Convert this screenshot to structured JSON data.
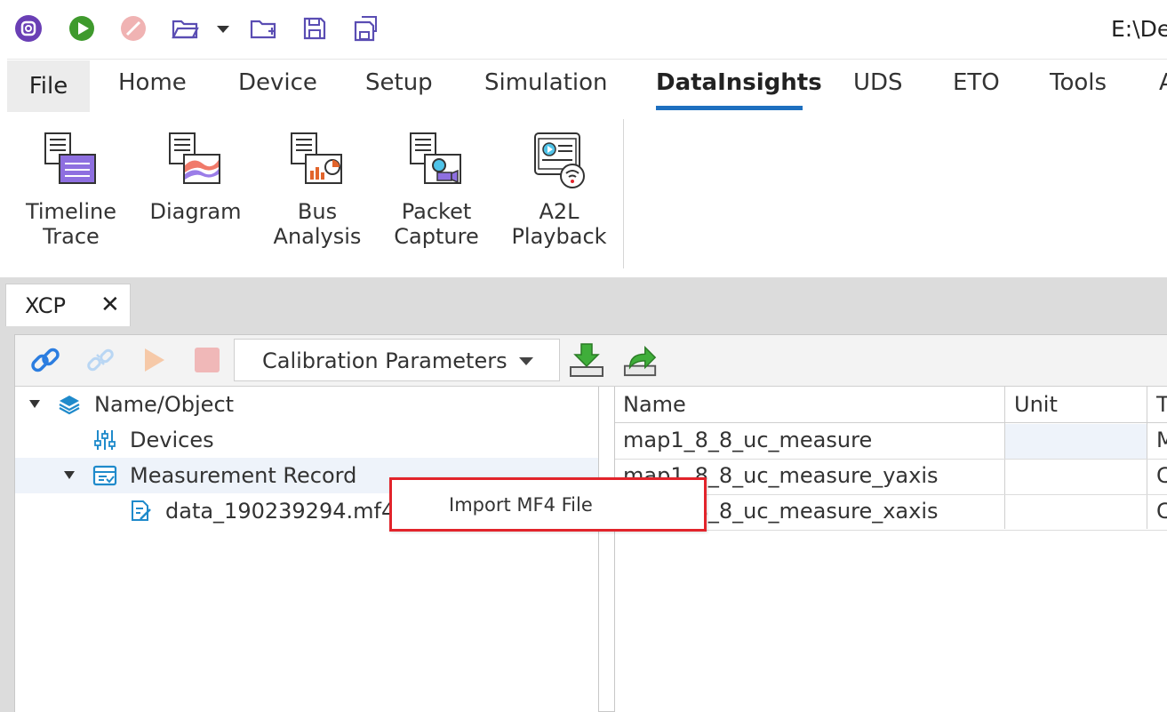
{
  "quick_access": {
    "icons": [
      "app-logo-icon",
      "run-icon",
      "stop-icon",
      "open-folder-icon",
      "dropdown-icon",
      "new-folder-icon",
      "save-icon",
      "save-as-icon"
    ],
    "path_text": "E:\\De"
  },
  "ribbon_tabs": {
    "file": "File",
    "items": [
      "Home",
      "Device",
      "Setup",
      "Simulation",
      "DataInsights",
      "UDS",
      "ETO",
      "Tools",
      "A"
    ],
    "active": "DataInsights"
  },
  "ribbon_buttons": [
    {
      "line1": "Timeline",
      "line2": "Trace",
      "icon": "timeline-trace-icon"
    },
    {
      "line1": "Diagram",
      "line2": "",
      "icon": "diagram-icon"
    },
    {
      "line1": "Bus",
      "line2": "Analysis",
      "icon": "bus-analysis-icon"
    },
    {
      "line1": "Packet",
      "line2": "Capture",
      "icon": "packet-capture-icon"
    },
    {
      "line1": "A2L",
      "line2": "Playback",
      "icon": "a2l-playback-icon"
    }
  ],
  "doc_tab": {
    "label": "XCP",
    "close": "✕"
  },
  "toolbar": {
    "combo_value": "Calibration Parameters",
    "buttons": [
      "connect-icon",
      "disconnect-icon",
      "start-icon",
      "stop-icon",
      "download-icon",
      "export-icon"
    ]
  },
  "tree": {
    "root": "Name/Object",
    "devices": "Devices",
    "measurement_record": "Measurement Record",
    "file": "data_190239294.mf4"
  },
  "grid": {
    "columns": [
      "Name",
      "Unit",
      "T"
    ],
    "rows": [
      {
        "name": "map1_8_8_uc_measure",
        "unit": "",
        "t": "M"
      },
      {
        "name": "map1_8_8_uc_measure_yaxis",
        "unit": "",
        "t": "C"
      },
      {
        "name": "map1_8_8_uc_measure_xaxis",
        "unit": "",
        "t": "C"
      }
    ]
  },
  "context_menu": {
    "items": [
      "Import MF4 File"
    ],
    "highlight_color": "#e2242b"
  },
  "colors": {
    "accent": "#1e6fbf",
    "tab_file_bg": "#ececec"
  }
}
